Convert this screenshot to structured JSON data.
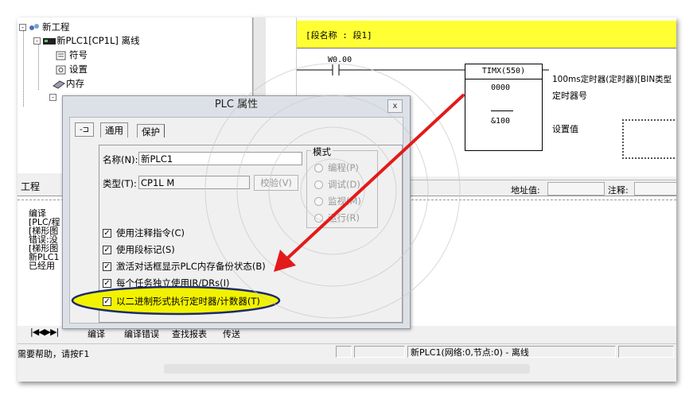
{
  "tree": {
    "project": "新工程",
    "plc": "新PLC1[CP1L] 离线",
    "items": [
      "符号",
      "设置",
      "内存"
    ]
  },
  "ladder": {
    "section_label": "[段名称 : 段1]",
    "contact": "W0.00",
    "instr": "TIMX(550)",
    "op1": "0000",
    "op2": "&100",
    "comment_main": "100ms定时器(定时器)[BIN类型",
    "comment_timer": "定时器号",
    "comment_set": "设置值"
  },
  "infobar": {
    "address": "地址值:",
    "comment": "注释:"
  },
  "left_tab": "工程",
  "output_lines": [
    "编译",
    "[PLC/程",
    "[梯形图",
    "错误:没",
    "[梯形图",
    "",
    "新PLC1",
    "已经用"
  ],
  "bottom_tabs": [
    "编译",
    "编译错误",
    "查找报表",
    "传送"
  ],
  "status": {
    "help": "需要帮助，请按F1",
    "plc": "新PLC1(网络:0,节点:0) - 离线"
  },
  "dialog": {
    "title": "PLC 属性",
    "close": "x",
    "pin": "-⊐",
    "tabs": [
      "通用",
      "保护"
    ],
    "name_label": "名称(N):",
    "name_value": "新PLC1",
    "type_label": "类型(T):",
    "type_value": "CP1L M",
    "verify_button": "校验(V)",
    "mode_title": "模式",
    "modes": [
      "编程(P)",
      "调试(D)",
      "监视(M)",
      "运行(R)"
    ],
    "options": [
      "使用注释指令(C)",
      "使用段标记(S)",
      "激活对话框显示PLC内存备份状态(B)",
      "每个任务独立使用IR/DRs(I)",
      "以二进制形式执行定时器/计数器(T)"
    ],
    "check_mark": "✓"
  },
  "colors": {
    "highlight": "#f2f200",
    "ellipse_border": "#1c2a6e",
    "arrow": "#e31a1a",
    "section_bar": "#ffff33"
  }
}
